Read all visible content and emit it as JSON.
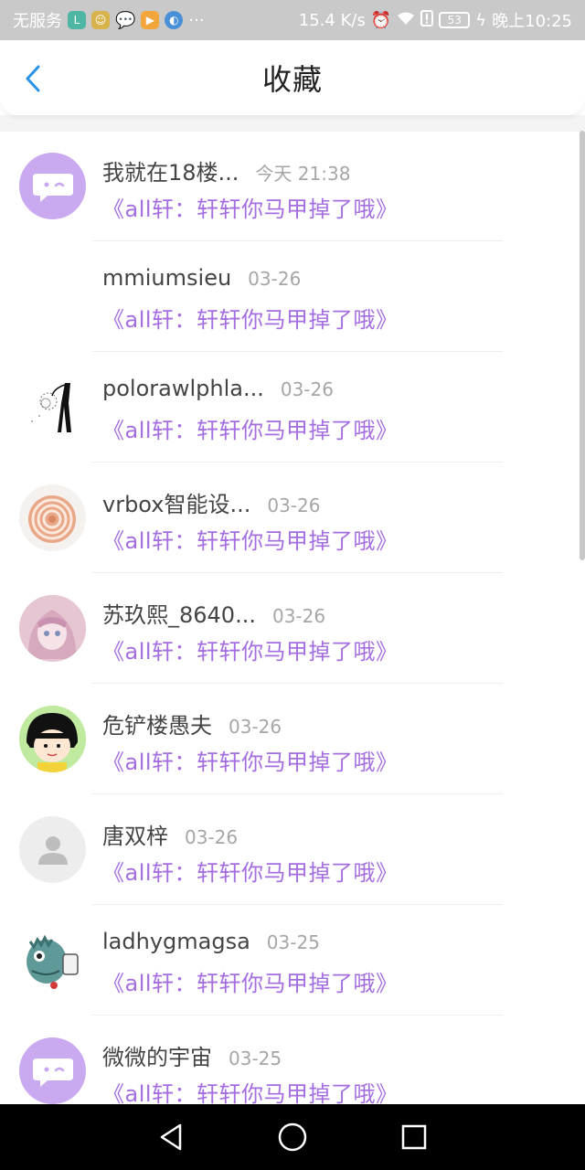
{
  "status_bar": {
    "carrier": "无服务",
    "speed": "15.4 K/s",
    "battery": "53",
    "time": "晚上10:25",
    "ellipsis": "···",
    "icons": [
      "app-l-icon",
      "app-face-icon",
      "wechat-icon",
      "video-icon",
      "browser-icon",
      "alarm-icon",
      "wifi-icon",
      "alert-icon",
      "battery-icon",
      "charging-icon"
    ]
  },
  "header": {
    "title": "收藏",
    "back_icon": "chevron-left-icon"
  },
  "accent_color": "#a56ee0",
  "items": [
    {
      "name": "我就在18楼...",
      "time": "今天 21:38",
      "message": "《all轩：轩轩你马甲掉了哦》",
      "avatar": "purple-chat-avatar"
    },
    {
      "name": "mmiumsieu",
      "time": "03-26",
      "message": "《all轩：轩轩你马甲掉了哦》",
      "avatar": "blank-avatar"
    },
    {
      "name": "polorawlphla...",
      "time": "03-26",
      "message": "《all轩：轩轩你马甲掉了哦》",
      "avatar": "sketch-figure-avatar"
    },
    {
      "name": "vrbox智能设...",
      "time": "03-26",
      "message": "《all轩：轩轩你马甲掉了哦》",
      "avatar": "shell-avatar"
    },
    {
      "name": "苏玖熙_8640...",
      "time": "03-26",
      "message": "《all轩：轩轩你马甲掉了哦》",
      "avatar": "anime-girl-avatar"
    },
    {
      "name": "危铲楼愚夫",
      "time": "03-26",
      "message": "《all轩：轩轩你马甲掉了哦》",
      "avatar": "cartoon-girl-avatar"
    },
    {
      "name": "唐双梓",
      "time": "03-26",
      "message": "《all轩：轩轩你马甲掉了哦》",
      "avatar": "default-person-avatar"
    },
    {
      "name": "ladhygmagsa",
      "time": "03-25",
      "message": "《all轩：轩轩你马甲掉了哦》",
      "avatar": "monster-avatar"
    },
    {
      "name": "微微的宇宙",
      "time": "03-25",
      "message": "《all轩：轩轩你马甲掉了哦》",
      "avatar": "purple-chat-avatar"
    }
  ],
  "nav": {
    "back": "nav-back-icon",
    "home": "nav-home-icon",
    "recents": "nav-recents-icon"
  }
}
